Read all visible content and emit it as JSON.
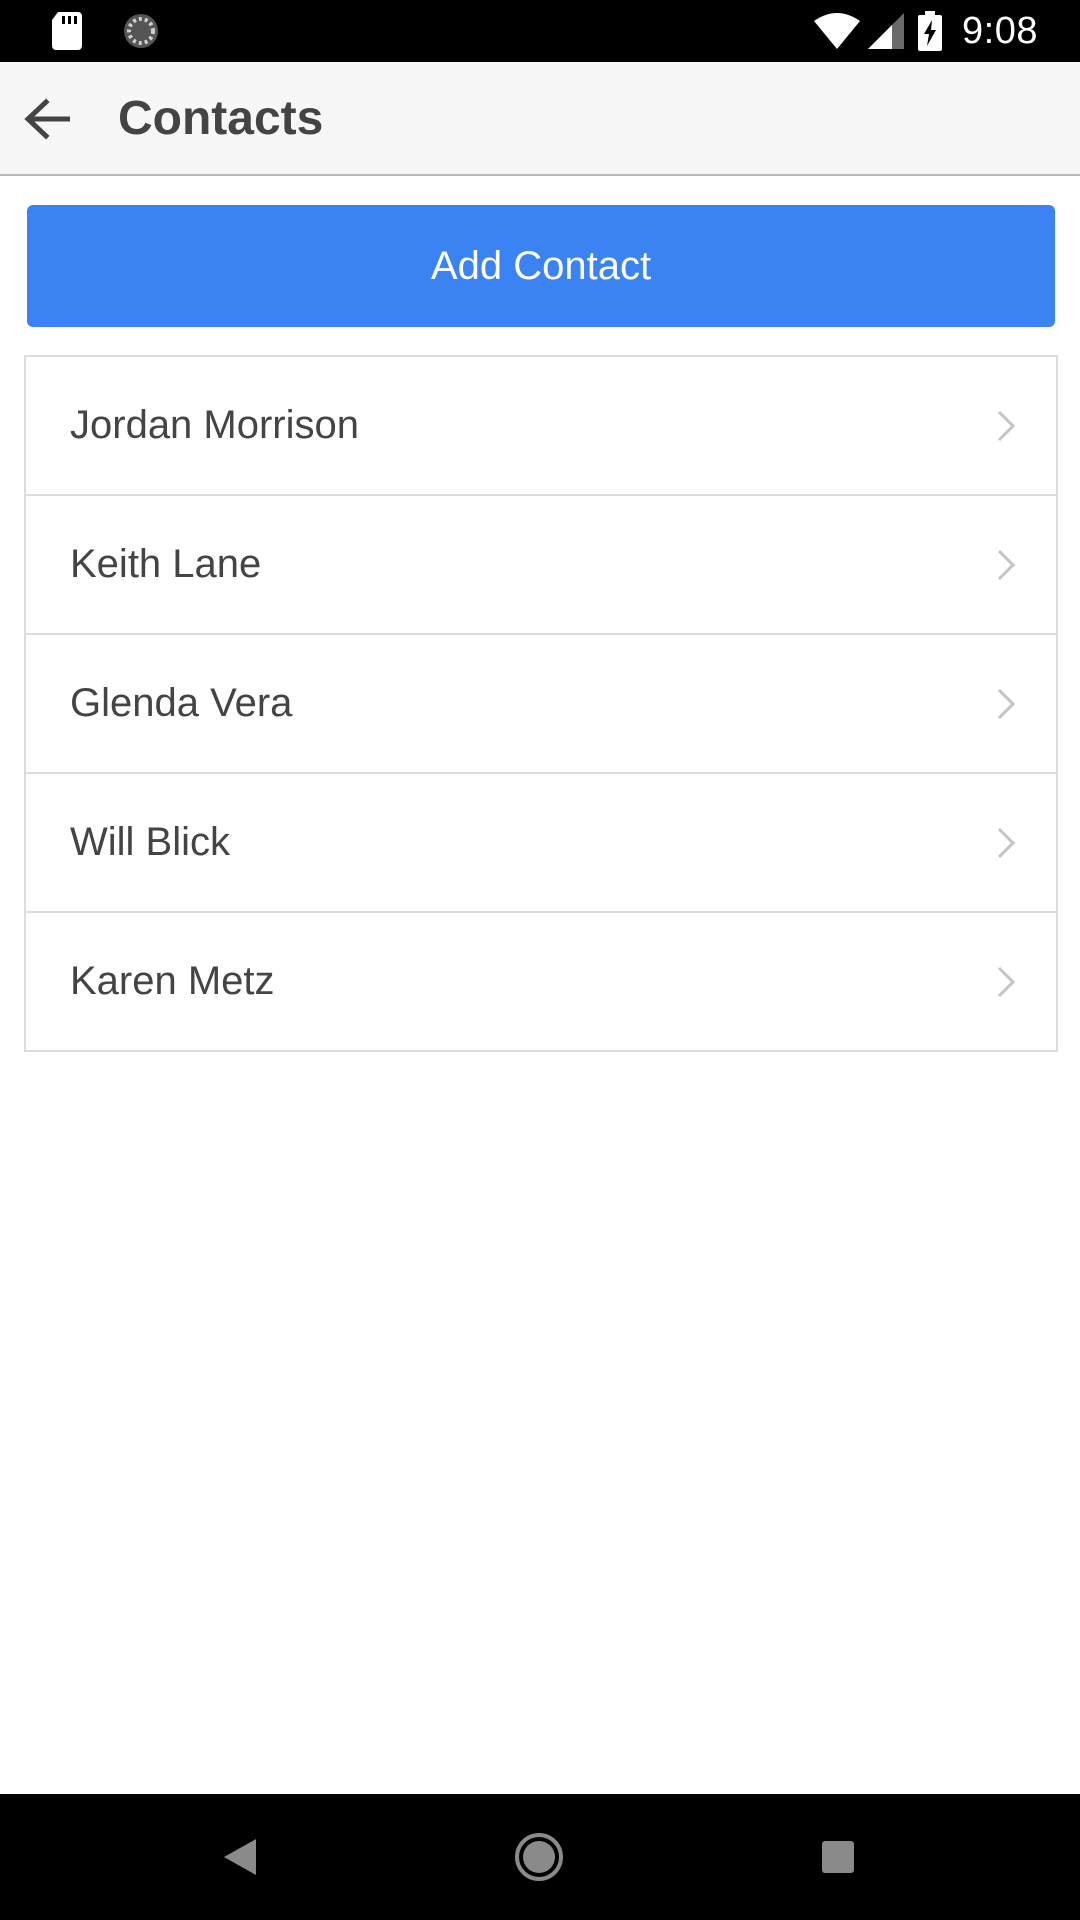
{
  "status_bar": {
    "time": "9:08",
    "left_icons": [
      "sd-card-icon",
      "sync-spinner-icon"
    ],
    "right_icons": [
      "wifi-icon",
      "cell-signal-icon",
      "battery-charging-icon"
    ]
  },
  "app_bar": {
    "title": "Contacts",
    "back_icon": "arrow-back-icon"
  },
  "actions": {
    "add_contact_label": "Add Contact"
  },
  "contacts": [
    {
      "name": "Jordan Morrison"
    },
    {
      "name": "Keith Lane"
    },
    {
      "name": "Glenda Vera"
    },
    {
      "name": "Will Blick"
    },
    {
      "name": "Karen Metz"
    }
  ],
  "nav_bar": {
    "buttons": [
      "back-triangle-icon",
      "home-circle-icon",
      "recents-square-icon"
    ]
  },
  "colors": {
    "accent": "#3b82f3",
    "text": "#444444",
    "divider": "#dcdcdc",
    "app_bar_bg": "#f7f7f7"
  }
}
